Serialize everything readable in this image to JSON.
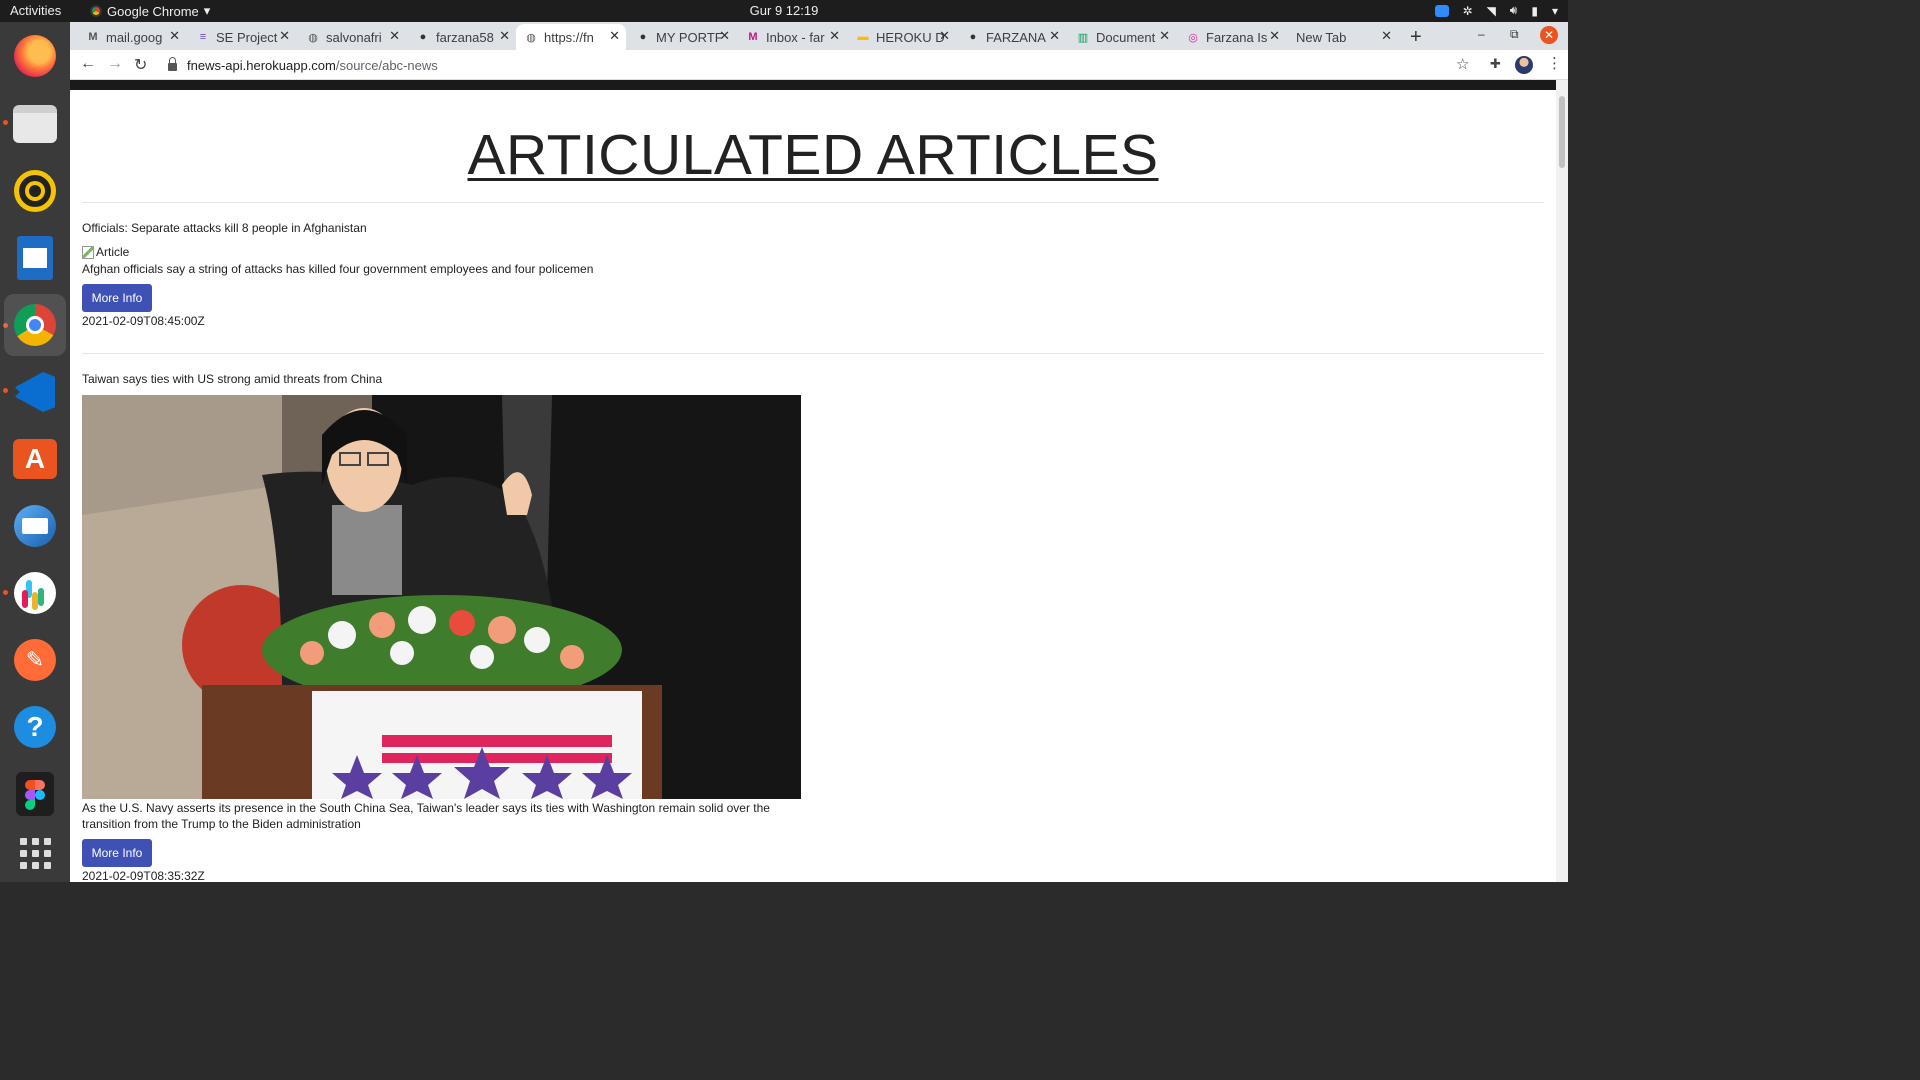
{
  "system_bar": {
    "activities": "Activities",
    "app_name": "Google Chrome",
    "datetime": "Gur 9  12:19"
  },
  "tabs": [
    {
      "title": "mail.goog",
      "icon": "gmail-icon",
      "color": "#555"
    },
    {
      "title": "SE Project",
      "icon": "docs-icon",
      "color": "#7248b9"
    },
    {
      "title": "salvonafri",
      "icon": "globe-icon",
      "color": "#555"
    },
    {
      "title": "farzana58",
      "icon": "github-icon",
      "color": "#333"
    },
    {
      "title": "https://fn",
      "icon": "globe-icon",
      "color": "#555"
    },
    {
      "title": "MY PORTF",
      "icon": "github-icon",
      "color": "#333"
    },
    {
      "title": "Inbox - far",
      "icon": "gmail-icon",
      "color": "#c71585"
    },
    {
      "title": "HEROKU D",
      "icon": "keep-icon",
      "color": "#fbbc04"
    },
    {
      "title": "FARZANA",
      "icon": "github-icon",
      "color": "#333"
    },
    {
      "title": "Document",
      "icon": "sheets-icon",
      "color": "#0f9d58"
    },
    {
      "title": "Farzana Is",
      "icon": "instagram-icon",
      "color": "#d6249f"
    },
    {
      "title": "New Tab",
      "icon": "",
      "color": "#555"
    }
  ],
  "address_bar": {
    "host": "fnews-api.herokuapp.com",
    "path": "/source/abc-news"
  },
  "page": {
    "heading": "ARTICULATED ARTICLES",
    "articles": [
      {
        "title": "Officials: Separate attacks kill 8 people in Afghanistan",
        "image_alt": "Article",
        "description": "Afghan officials say a string of attacks has killed four government employees and four policemen",
        "button": "More Info",
        "published": "2021-02-09T08:45:00Z"
      },
      {
        "title": "Taiwan says ties with US strong amid threats from China",
        "description": "As the U.S. Navy asserts its presence in the South China Sea, Taiwan's leader says its ties with Washington remain solid over the transition from the Trump to the Biden administration",
        "button": "More Info",
        "published": "2021-02-09T08:35:32Z"
      }
    ]
  },
  "colors": {
    "button": "#3f51b5",
    "accent": "#e95420"
  }
}
